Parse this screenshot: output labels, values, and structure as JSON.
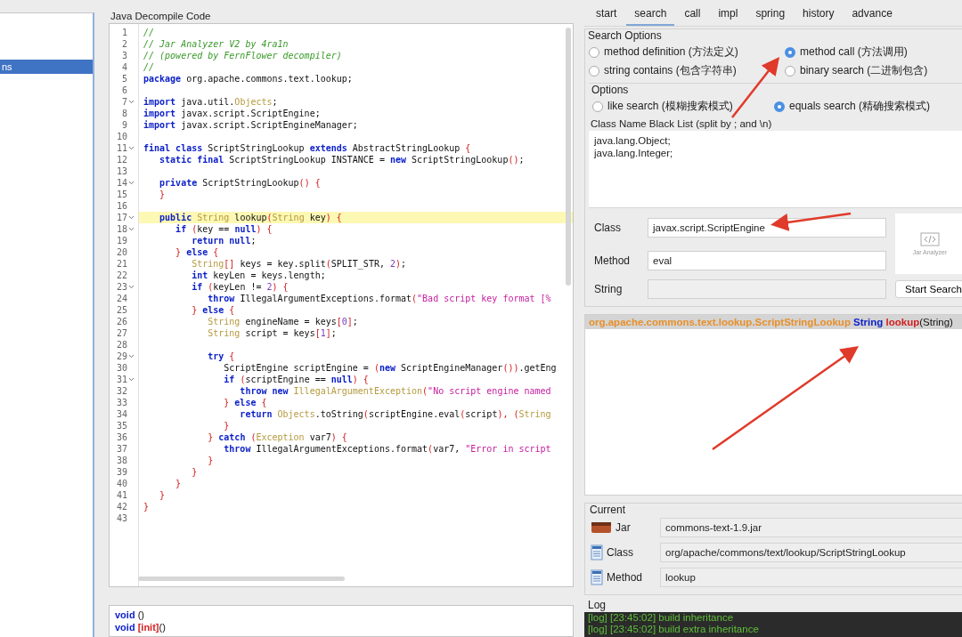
{
  "sidebar": {
    "items": [
      {
        "label": "ns",
        "selected": true
      }
    ]
  },
  "code_panel": {
    "title": "Java Decompile Code",
    "lines": [
      {
        "n": "1",
        "fold": false,
        "hl": false,
        "t": [
          {
            "kind": "comment",
            "text": "//"
          }
        ]
      },
      {
        "n": "2",
        "fold": false,
        "hl": false,
        "t": [
          {
            "kind": "comment",
            "text": "// Jar Analyzer V2 by 4ra1n"
          }
        ]
      },
      {
        "n": "3",
        "fold": false,
        "hl": false,
        "t": [
          {
            "kind": "comment",
            "text": "// (powered by FernFlower decompiler)"
          }
        ]
      },
      {
        "n": "4",
        "fold": false,
        "hl": false,
        "t": [
          {
            "kind": "comment",
            "text": "//"
          }
        ]
      },
      {
        "n": "5",
        "fold": false,
        "hl": false,
        "t": [
          {
            "kind": "keyword",
            "text": "package"
          },
          {
            "kind": "plain",
            "text": " org.apache.commons.text.lookup;"
          }
        ]
      },
      {
        "n": "6",
        "fold": false,
        "hl": false
      },
      {
        "n": "7",
        "fold": true,
        "hl": false,
        "t": [
          {
            "kind": "keyword",
            "text": "import"
          },
          {
            "kind": "plain",
            "text": " java.util."
          },
          {
            "kind": "type",
            "text": "Objects"
          },
          {
            "kind": "plain",
            "text": ";"
          }
        ]
      },
      {
        "n": "8",
        "fold": false,
        "hl": false,
        "t": [
          {
            "kind": "keyword",
            "text": "import"
          },
          {
            "kind": "plain",
            "text": " javax.script.ScriptEngine;"
          }
        ]
      },
      {
        "n": "9",
        "fold": false,
        "hl": false,
        "t": [
          {
            "kind": "keyword",
            "text": "import"
          },
          {
            "kind": "plain",
            "text": " javax.script.ScriptEngineManager;"
          }
        ]
      },
      {
        "n": "10",
        "fold": false,
        "hl": false
      },
      {
        "n": "11",
        "fold": true,
        "hl": false,
        "t": [
          {
            "kind": "keyword",
            "text": "final class"
          },
          {
            "kind": "plain",
            "text": " ScriptStringLookup "
          },
          {
            "kind": "keyword",
            "text": "extends"
          },
          {
            "kind": "plain",
            "text": " AbstractStringLookup "
          },
          {
            "kind": "punct",
            "text": "{"
          }
        ]
      },
      {
        "n": "12",
        "fold": false,
        "hl": false,
        "t": [
          {
            "kind": "keyword",
            "text": "   static final"
          },
          {
            "kind": "plain",
            "text": " ScriptStringLookup INSTANCE = "
          },
          {
            "kind": "keyword",
            "text": "new"
          },
          {
            "kind": "plain",
            "text": " ScriptStringLookup"
          },
          {
            "kind": "punct",
            "text": "()"
          },
          {
            "kind": "plain",
            "text": ";"
          }
        ]
      },
      {
        "n": "13",
        "fold": false,
        "hl": false
      },
      {
        "n": "14",
        "fold": true,
        "hl": false,
        "t": [
          {
            "kind": "keyword",
            "text": "   private"
          },
          {
            "kind": "plain",
            "text": " ScriptStringLookup"
          },
          {
            "kind": "punct",
            "text": "() {"
          }
        ]
      },
      {
        "n": "15",
        "fold": false,
        "hl": false,
        "t": [
          {
            "kind": "punct",
            "text": "   }"
          }
        ]
      },
      {
        "n": "16",
        "fold": false,
        "hl": false
      },
      {
        "n": "17",
        "fold": true,
        "hl": true,
        "t": [
          {
            "kind": "keyword",
            "text": "   public"
          },
          {
            "kind": "type",
            "text": " String"
          },
          {
            "kind": "plain",
            "text": " lookup"
          },
          {
            "kind": "punct",
            "text": "("
          },
          {
            "kind": "type",
            "text": "String"
          },
          {
            "kind": "plain",
            "text": " key"
          },
          {
            "kind": "punct",
            "text": ") {"
          }
        ]
      },
      {
        "n": "18",
        "fold": true,
        "hl": false,
        "t": [
          {
            "kind": "keyword",
            "text": "      if"
          },
          {
            "kind": "punct",
            "text": " ("
          },
          {
            "kind": "plain",
            "text": "key == "
          },
          {
            "kind": "keyword",
            "text": "null"
          },
          {
            "kind": "punct",
            "text": ") {"
          }
        ]
      },
      {
        "n": "19",
        "fold": false,
        "hl": false,
        "t": [
          {
            "kind": "keyword",
            "text": "         return null"
          },
          {
            "kind": "plain",
            "text": ";"
          }
        ]
      },
      {
        "n": "20",
        "fold": false,
        "hl": false,
        "t": [
          {
            "kind": "punct",
            "text": "      }"
          },
          {
            "kind": "keyword",
            "text": " else"
          },
          {
            "kind": "punct",
            "text": " {"
          }
        ]
      },
      {
        "n": "21",
        "fold": false,
        "hl": false,
        "t": [
          {
            "kind": "type",
            "text": "         String"
          },
          {
            "kind": "punct",
            "text": "[]"
          },
          {
            "kind": "plain",
            "text": " keys = key.split"
          },
          {
            "kind": "punct",
            "text": "("
          },
          {
            "kind": "plain",
            "text": "SPLIT_STR, "
          },
          {
            "kind": "number",
            "text": "2"
          },
          {
            "kind": "punct",
            "text": ")"
          },
          {
            "kind": "plain",
            "text": ";"
          }
        ]
      },
      {
        "n": "22",
        "fold": false,
        "hl": false,
        "t": [
          {
            "kind": "keyword",
            "text": "         int"
          },
          {
            "kind": "plain",
            "text": " keyLen = keys.length;"
          }
        ]
      },
      {
        "n": "23",
        "fold": true,
        "hl": false,
        "t": [
          {
            "kind": "keyword",
            "text": "         if"
          },
          {
            "kind": "punct",
            "text": " ("
          },
          {
            "kind": "plain",
            "text": "keyLen != "
          },
          {
            "kind": "number",
            "text": "2"
          },
          {
            "kind": "punct",
            "text": ") {"
          }
        ]
      },
      {
        "n": "24",
        "fold": false,
        "hl": false,
        "t": [
          {
            "kind": "keyword",
            "text": "            throw"
          },
          {
            "kind": "plain",
            "text": " IllegalArgumentExceptions.format"
          },
          {
            "kind": "punct",
            "text": "("
          },
          {
            "kind": "string",
            "text": "\"Bad script key format [%"
          }
        ]
      },
      {
        "n": "25",
        "fold": false,
        "hl": false,
        "t": [
          {
            "kind": "punct",
            "text": "         }"
          },
          {
            "kind": "keyword",
            "text": " else"
          },
          {
            "kind": "punct",
            "text": " {"
          }
        ]
      },
      {
        "n": "26",
        "fold": false,
        "hl": false,
        "t": [
          {
            "kind": "type",
            "text": "            String"
          },
          {
            "kind": "plain",
            "text": " engineName = keys"
          },
          {
            "kind": "punct",
            "text": "["
          },
          {
            "kind": "number",
            "text": "0"
          },
          {
            "kind": "punct",
            "text": "]"
          },
          {
            "kind": "plain",
            "text": ";"
          }
        ]
      },
      {
        "n": "27",
        "fold": false,
        "hl": false,
        "t": [
          {
            "kind": "type",
            "text": "            String"
          },
          {
            "kind": "plain",
            "text": " script = keys"
          },
          {
            "kind": "punct",
            "text": "["
          },
          {
            "kind": "number",
            "text": "1"
          },
          {
            "kind": "punct",
            "text": "]"
          },
          {
            "kind": "plain",
            "text": ";"
          }
        ]
      },
      {
        "n": "28",
        "fold": false,
        "hl": false
      },
      {
        "n": "29",
        "fold": true,
        "hl": false,
        "t": [
          {
            "kind": "keyword",
            "text": "            try"
          },
          {
            "kind": "punct",
            "text": " {"
          }
        ]
      },
      {
        "n": "30",
        "fold": false,
        "hl": false,
        "t": [
          {
            "kind": "plain",
            "text": "               ScriptEngine scriptEngine = "
          },
          {
            "kind": "punct",
            "text": "("
          },
          {
            "kind": "keyword",
            "text": "new"
          },
          {
            "kind": "plain",
            "text": " ScriptEngineManager"
          },
          {
            "kind": "punct",
            "text": "())"
          },
          {
            "kind": "plain",
            "text": ".getEng"
          }
        ]
      },
      {
        "n": "31",
        "fold": true,
        "hl": false,
        "t": [
          {
            "kind": "keyword",
            "text": "               if"
          },
          {
            "kind": "punct",
            "text": " ("
          },
          {
            "kind": "plain",
            "text": "scriptEngine == "
          },
          {
            "kind": "keyword",
            "text": "null"
          },
          {
            "kind": "punct",
            "text": ") {"
          }
        ]
      },
      {
        "n": "32",
        "fold": false,
        "hl": false,
        "t": [
          {
            "kind": "keyword",
            "text": "                  throw new"
          },
          {
            "kind": "type",
            "text": " IllegalArgumentException"
          },
          {
            "kind": "punct",
            "text": "("
          },
          {
            "kind": "string",
            "text": "\"No script engine named"
          }
        ]
      },
      {
        "n": "33",
        "fold": false,
        "hl": false,
        "t": [
          {
            "kind": "punct",
            "text": "               }"
          },
          {
            "kind": "keyword",
            "text": " else"
          },
          {
            "kind": "punct",
            "text": " {"
          }
        ]
      },
      {
        "n": "34",
        "fold": false,
        "hl": false,
        "t": [
          {
            "kind": "keyword",
            "text": "                  return"
          },
          {
            "kind": "type",
            "text": " Objects"
          },
          {
            "kind": "plain",
            "text": ".toString"
          },
          {
            "kind": "punct",
            "text": "("
          },
          {
            "kind": "plain",
            "text": "scriptEngine.eval"
          },
          {
            "kind": "punct",
            "text": "("
          },
          {
            "kind": "plain",
            "text": "script"
          },
          {
            "kind": "punct",
            "text": "), ("
          },
          {
            "kind": "type",
            "text": "String"
          }
        ]
      },
      {
        "n": "35",
        "fold": false,
        "hl": false,
        "t": [
          {
            "kind": "punct",
            "text": "               }"
          }
        ]
      },
      {
        "n": "36",
        "fold": false,
        "hl": false,
        "t": [
          {
            "kind": "punct",
            "text": "            }"
          },
          {
            "kind": "keyword",
            "text": " catch"
          },
          {
            "kind": "punct",
            "text": " ("
          },
          {
            "kind": "type",
            "text": "Exception"
          },
          {
            "kind": "plain",
            "text": " var7"
          },
          {
            "kind": "punct",
            "text": ") {"
          }
        ]
      },
      {
        "n": "37",
        "fold": false,
        "hl": false,
        "t": [
          {
            "kind": "keyword",
            "text": "               throw"
          },
          {
            "kind": "plain",
            "text": " IllegalArgumentExceptions.format"
          },
          {
            "kind": "punct",
            "text": "("
          },
          {
            "kind": "plain",
            "text": "var7, "
          },
          {
            "kind": "string",
            "text": "\"Error in script"
          }
        ]
      },
      {
        "n": "38",
        "fold": false,
        "hl": false,
        "t": [
          {
            "kind": "punct",
            "text": "            }"
          }
        ]
      },
      {
        "n": "39",
        "fold": false,
        "hl": false,
        "t": [
          {
            "kind": "punct",
            "text": "         }"
          }
        ]
      },
      {
        "n": "40",
        "fold": false,
        "hl": false,
        "t": [
          {
            "kind": "punct",
            "text": "      }"
          }
        ]
      },
      {
        "n": "41",
        "fold": false,
        "hl": false,
        "t": [
          {
            "kind": "punct",
            "text": "   }"
          }
        ]
      },
      {
        "n": "42",
        "fold": false,
        "hl": false,
        "t": [
          {
            "kind": "punct",
            "text": "}"
          }
        ]
      },
      {
        "n": "43",
        "fold": false,
        "hl": false
      }
    ]
  },
  "method_list": [
    [
      {
        "kind": "keyword",
        "text": "void"
      },
      {
        "kind": "plain",
        "text": " ()"
      }
    ],
    [
      {
        "kind": "keyword",
        "text": "void"
      },
      {
        "kind": "red",
        "text": " [init]"
      },
      {
        "kind": "plain",
        "text": "()"
      }
    ]
  ],
  "tabs": [
    {
      "label": "start",
      "selected": false
    },
    {
      "label": "search",
      "selected": true
    },
    {
      "label": "call",
      "selected": false
    },
    {
      "label": "impl",
      "selected": false
    },
    {
      "label": "spring",
      "selected": false
    },
    {
      "label": "history",
      "selected": false
    },
    {
      "label": "advance",
      "selected": false
    }
  ],
  "search_options": {
    "title": "Search Options",
    "modes": [
      {
        "label": "method definition (方法定义)",
        "selected": false
      },
      {
        "label": "method call (方法调用)",
        "selected": true
      },
      {
        "label": "string contains (包含字符串)",
        "selected": false
      },
      {
        "label": "binary search (二进制包含)",
        "selected": false
      }
    ],
    "options_title": "Options",
    "match": [
      {
        "label": "like search (模糊搜索模式)",
        "selected": false
      },
      {
        "label": "equals search (精确搜索模式)",
        "selected": true
      }
    ],
    "blacklist_label": "Class Name Black List (split by ; and \\n)",
    "blacklist": [
      "java.lang.Object;",
      "java.lang.Integer;"
    ],
    "fields": [
      {
        "label": "Class",
        "value": "javax.script.ScriptEngine",
        "disabled": false
      },
      {
        "label": "Method",
        "value": "eval",
        "disabled": false
      },
      {
        "label": "String",
        "disabled": true
      }
    ],
    "logo_caption": "Jar Analyzer",
    "button": "Start Search"
  },
  "results": [
    {
      "selected": true,
      "t": [
        {
          "kind": "package",
          "text": "org.apache.commons.text.lookup.ScriptStringLookup"
        },
        {
          "kind": "keyword",
          "text": " String"
        },
        {
          "kind": "red",
          "text": " lookup"
        },
        {
          "kind": "plain",
          "text": "(String)"
        }
      ]
    }
  ],
  "current": {
    "title": "Current",
    "rows": [
      {
        "kind": "jar",
        "label": "Jar",
        "value": "commons-text-1.9.jar"
      },
      {
        "kind": "class",
        "label": "Class",
        "value": "org/apache/commons/text/lookup/ScriptStringLookup"
      },
      {
        "kind": "method",
        "label": "Method",
        "value": "lookup"
      }
    ]
  },
  "log": {
    "title": "Log",
    "lines": [
      "[log] [23:45:02] build inheritance",
      "[log] [23:45:02] build extra inheritance"
    ]
  }
}
